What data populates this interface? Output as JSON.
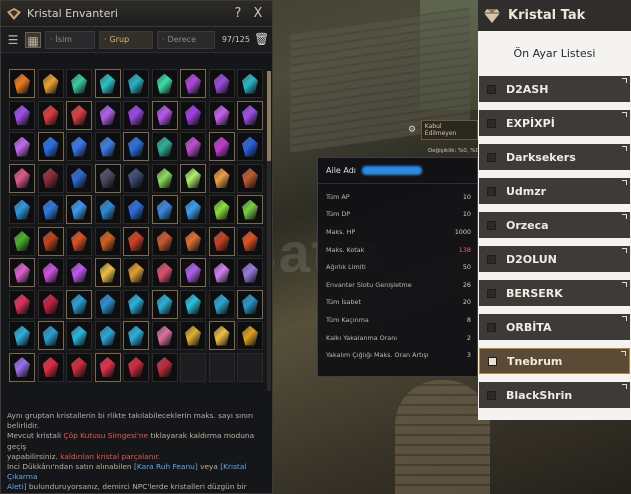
{
  "inventory": {
    "title": "Kristal Envanteri",
    "help_label": "?",
    "close_label": "X",
    "sort_name": "İsim",
    "sort_group": "Grup",
    "sort_grade": "Derece",
    "capacity": "97/125",
    "note_lines": [
      {
        "text": "Aynı gruptan kristallerin bi rlikte takılabileceklerin maks. sayı sınırı belirlidir."
      },
      {
        "text": "Mevcut kristali Çöp Kutusu Simgesi'ne tıklayarak kaldırma moduna geçiş"
      },
      {
        "text": "yapabilirsiniz. kaldırılan kristal parçalanır.",
        "red": "kaldırılan kristal parçalanır."
      },
      {
        "text": "İnci Dükkânı'ndan satın alınabilen [Kara Ruh Feanu] veya [Kristal Çıkarma"
      },
      {
        "text": "Aleti] bulunduruyorsanız, demirci NPC'lerde kristalleri düzgün bir şekilde"
      },
      {
        "text": "çıkarabilirsiniz."
      }
    ]
  },
  "gems": [
    [
      "#f07a1a",
      "#f0a030",
      "#37d0a0",
      "#2ac4c8",
      "#2ab0c8",
      "#38e0a8",
      "#b046e0",
      "#9a4ae0",
      "#2ab8c8"
    ],
    [
      "#a050f0",
      "#e03a3a",
      "#e04040",
      "#b060f0",
      "#9c48e6",
      "#ba58f0",
      "#9e40e8",
      "#c860f0",
      "#a050e8"
    ],
    [
      "#c468f0",
      "#2a6ee8",
      "#3a78f0",
      "#3a80e8",
      "#2a70e0",
      "#2ab09a",
      "#c04cd0",
      "#c23ad0",
      "#2a60e0"
    ],
    [
      "#e05a8a",
      "#8a2a3a",
      "#2a6ad0",
      "#4a4a60",
      "#3a4a70",
      "#8ae05a",
      "#aef06a",
      "#f0a040",
      "#c05a30"
    ],
    [
      "#2a9ae0",
      "#2a7ae0",
      "#3a9af0",
      "#2a8ad8",
      "#2a6ee0",
      "#3a8ae0",
      "#3aa0f0",
      "#8ae03a",
      "#7ad040"
    ],
    [
      "#4ab02a",
      "#c0401a",
      "#e05020",
      "#d06020",
      "#d04020",
      "#c85a2a",
      "#e07030",
      "#c84020",
      "#e05020"
    ],
    [
      "#e060d0",
      "#d050e0",
      "#c058f0",
      "#f0c040",
      "#e0a030",
      "#e05070",
      "#b060f0",
      "#d080f0",
      "#9a7ae0"
    ],
    [
      "#e03060",
      "#c02040",
      "#2aa0d8",
      "#2a90d0",
      "#2ab0e0",
      "#2ab0d8",
      "#2ac0e0",
      "#2aa8d0",
      "#2a98c8"
    ],
    [
      "#2ab0e0",
      "#2aa0d0",
      "#2ab8e0",
      "#2aa8d8",
      "#2ab0e0",
      "#e070a0",
      "#e0b030",
      "#f0c040",
      "#e0a020"
    ],
    [
      "#9a70f0",
      "#e02a40",
      "#d02a3a",
      "#e0304a",
      "#d02a40",
      "#c02a3a",
      "",
      "",
      ""
    ]
  ],
  "stats": {
    "family_label": "Aile Adı",
    "rows": [
      {
        "label": "Tüm AP",
        "value": "10"
      },
      {
        "label": "Tüm DP",
        "value": "10"
      },
      {
        "label": "Maks. HP",
        "value": "1000"
      },
      {
        "label": "Maks. Kotak",
        "value": "138",
        "red": true
      },
      {
        "label": "Ağırlık Limiti",
        "value": "50"
      },
      {
        "label": "Envanter Slotu Genişletme",
        "value": "26"
      },
      {
        "label": "Tüm İsabet",
        "value": "20"
      },
      {
        "label": "Tüm Kaçınma",
        "value": "8"
      },
      {
        "label": "Kalkı Yakalanma Oranı",
        "value": "2"
      },
      {
        "label": "Yakalım Çığlığı Maks. Oran Artışı",
        "value": "3"
      }
    ]
  },
  "hud": {
    "badge": "Kabul Edilmeyen",
    "coords": "Değişiklik: %0, %0"
  },
  "watermark": "bensatis",
  "presets_panel": {
    "title": "Kristal Tak",
    "subtitle": "Ön Ayar Listesi",
    "items": [
      {
        "label": "D2ASH"
      },
      {
        "label": "EXPİXPİ"
      },
      {
        "label": "Darksekers"
      },
      {
        "label": "Udmzr"
      },
      {
        "label": "Orzeca"
      },
      {
        "label": "D2OLUN"
      },
      {
        "label": "BERSERK"
      },
      {
        "label": "ORBİTA"
      },
      {
        "label": "Tnebrum",
        "active": true
      },
      {
        "label": "BlackShrin"
      }
    ]
  }
}
